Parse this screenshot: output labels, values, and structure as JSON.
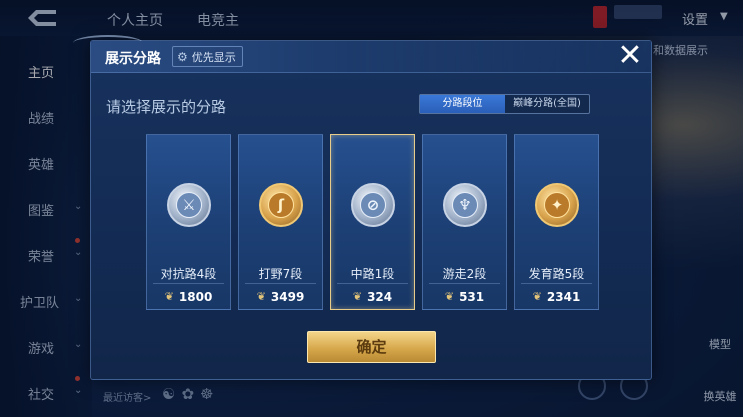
{
  "topbar": {
    "tabs": [
      "个人主页",
      "电竞主"
    ],
    "settings_label": "设置"
  },
  "sidebar": {
    "items": [
      {
        "label": "主页",
        "active": true
      },
      {
        "label": "战绩"
      },
      {
        "label": "英雄"
      },
      {
        "label": "图鉴"
      },
      {
        "label": "荣誉"
      },
      {
        "label": "护卫队"
      },
      {
        "label": "游戏"
      },
      {
        "label": "社交"
      }
    ]
  },
  "background": {
    "right_top_label": "和数据展示",
    "right_btn_1": "模型",
    "right_btn_2": "换英雄",
    "recent_visit": "最近访客>"
  },
  "dialog": {
    "title": "展示分路",
    "priority_label": "优先显示",
    "close_icon": "close-icon",
    "subtitle": "请选择展示的分路",
    "segment": {
      "options": [
        "分路段位",
        "巅峰分路(全国)"
      ],
      "selected_index": 0
    },
    "cards": [
      {
        "label": "对抗路4段",
        "score": "1800",
        "medal": "silver",
        "glyph": "⚔",
        "selected": false
      },
      {
        "label": "打野7段",
        "score": "3499",
        "medal": "gold",
        "glyph": "ʃ",
        "selected": false
      },
      {
        "label": "中路1段",
        "score": "324",
        "medal": "silver",
        "glyph": "⊘",
        "selected": true
      },
      {
        "label": "游走2段",
        "score": "531",
        "medal": "silver",
        "glyph": "♆",
        "selected": false
      },
      {
        "label": "发育路5段",
        "score": "2341",
        "medal": "gold",
        "glyph": "✦",
        "selected": false
      }
    ],
    "confirm_label": "确定"
  },
  "colors": {
    "accent_blue": "#2a5fb8",
    "gold": "#d7a84c",
    "panel": "#17325e"
  }
}
